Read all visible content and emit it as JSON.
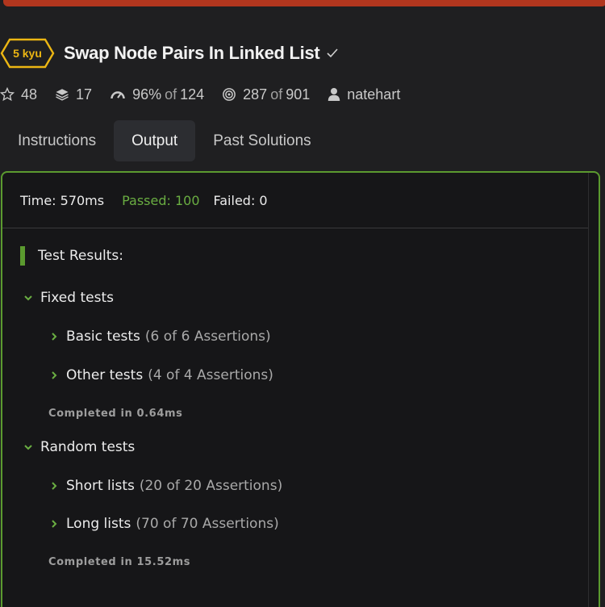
{
  "kata": {
    "rank": "5 kyu",
    "title": "Swap Node Pairs In Linked List",
    "stats": {
      "stars": "48",
      "collections": "17",
      "satisfaction_pct": "96%",
      "satisfaction_of": "of",
      "satisfaction_total": "124",
      "completed": "287",
      "completed_of": "of",
      "completed_total": "901",
      "author": "natehart"
    }
  },
  "tabs": [
    {
      "label": "Instructions"
    },
    {
      "label": "Output"
    },
    {
      "label": "Past Solutions"
    }
  ],
  "output": {
    "time": "Time: 570ms",
    "passed": "Passed: 100",
    "failed": "Failed: 0",
    "results_title": "Test Results:",
    "groups": [
      {
        "title": "Fixed tests",
        "tests": [
          {
            "name": "Basic tests",
            "assertions": "(6 of 6 Assertions)"
          },
          {
            "name": "Other tests",
            "assertions": "(4 of 4 Assertions)"
          }
        ],
        "completed": "Completed in 0.64ms"
      },
      {
        "title": "Random tests",
        "tests": [
          {
            "name": "Short lists",
            "assertions": "(20 of 20 Assertions)"
          },
          {
            "name": "Long lists",
            "assertions": "(70 of 70 Assertions)"
          }
        ],
        "completed": "Completed in 15.52ms"
      }
    ]
  },
  "colors": {
    "accent_green": "#5b9a2f",
    "passed_green": "#6aae42",
    "rank_yellow": "#ecb613",
    "top_bar_red": "#b1361e"
  }
}
